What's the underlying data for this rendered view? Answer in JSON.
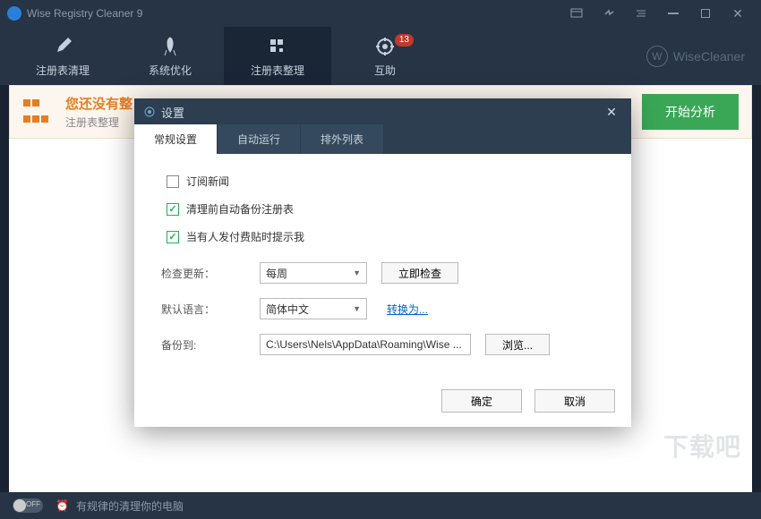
{
  "titlebar": {
    "app_title": "Wise Registry Cleaner 9"
  },
  "toolbar": {
    "items": [
      {
        "label": "注册表清理"
      },
      {
        "label": "系统优化"
      },
      {
        "label": "注册表整理"
      },
      {
        "label": "互助",
        "badge": "13"
      }
    ],
    "brand": "WiseCleaner"
  },
  "banner": {
    "title": "您还没有整",
    "subtitle": "注册表整理",
    "start_btn": "开始分析"
  },
  "statusbar": {
    "toggle_text": "OFF",
    "message": "有规律的清理你的电脑"
  },
  "watermark": "下载吧",
  "dialog": {
    "title": "设置",
    "tabs": [
      "常规设置",
      "自动运行",
      "排外列表"
    ],
    "checkboxes": {
      "subscribe_news": "订阅新闻",
      "backup_before_clean": "清理前自动备份注册表",
      "notify_paid_post": "当有人发付费贴时提示我"
    },
    "fields": {
      "check_update_label": "检查更新：",
      "check_update_value": "每周",
      "check_now_btn": "立即检查",
      "language_label": "默认语言：",
      "language_value": "简体中文",
      "convert_link": "转换为...",
      "backup_to_label": "备份到:",
      "backup_path": "C:\\Users\\Nels\\AppData\\Roaming\\Wise ...",
      "browse_btn": "浏览..."
    },
    "footer": {
      "ok": "确定",
      "cancel": "取消"
    }
  }
}
